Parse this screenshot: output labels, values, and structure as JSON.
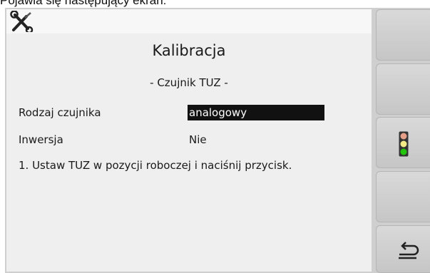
{
  "caption": "Pojawia się następujący ekran:",
  "screen": {
    "title": "Kalibracja",
    "subtitle": "- Czujnik TUZ -",
    "sensor_type": {
      "label": "Rodzaj czujnika",
      "value": "analogowy"
    },
    "inversion": {
      "label": "Inwersja",
      "value": "Nie"
    },
    "instruction": "1. Ustaw TUZ w pozycji roboczej i naciśnij przycisk."
  },
  "icons": {
    "tools": "tools-icon",
    "traffic_light": "traffic-light-icon",
    "back": "back-arrow-icon"
  },
  "colors": {
    "highlight_bg": "#111111",
    "highlight_text": "#ffffff",
    "traffic_top": "#e6a08a",
    "traffic_mid": "#f2ea86",
    "traffic_bottom": "#22c40c"
  }
}
